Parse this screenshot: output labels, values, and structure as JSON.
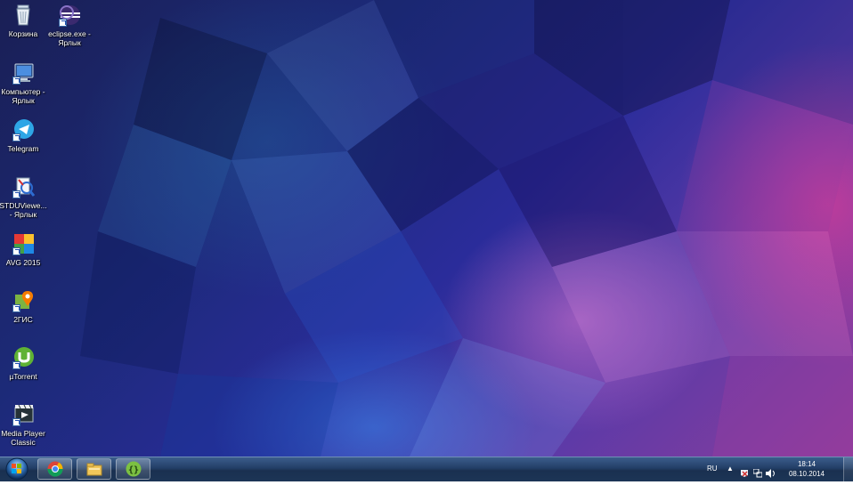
{
  "desktop": {
    "icons": [
      {
        "name": "recycle-bin-icon",
        "label": "Корзина"
      },
      {
        "name": "eclipse-icon",
        "label": "eclipse.exe - Ярлык"
      },
      {
        "name": "computer-icon",
        "label": "Компьютер - Ярлык"
      },
      {
        "name": "telegram-icon",
        "label": "Telegram"
      },
      {
        "name": "stdu-viewer-icon",
        "label": "STDUViewe... - Ярлык"
      },
      {
        "name": "avg-icon",
        "label": "AVG 2015"
      },
      {
        "name": "2gis-icon",
        "label": "2ГИС"
      },
      {
        "name": "utorrent-icon",
        "label": "µTorrent"
      },
      {
        "name": "media-player-classic-icon",
        "label": "Media Player Classic"
      }
    ]
  },
  "taskbar": {
    "pinned": [
      {
        "name": "chrome-icon"
      },
      {
        "name": "file-explorer-icon"
      },
      {
        "name": "brackets-icon"
      }
    ],
    "tray": {
      "language": "RU",
      "time": "18:14",
      "date": "08.10.2014"
    }
  },
  "colors": {
    "taskbar": "#223e66",
    "accent_pink": "#eb3c96",
    "wallpaper_base": "#1c2a78"
  }
}
